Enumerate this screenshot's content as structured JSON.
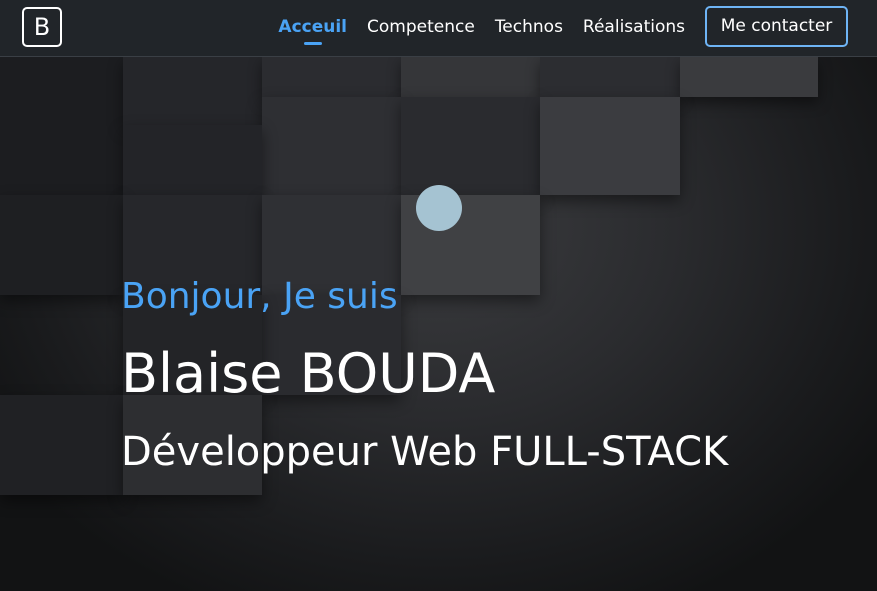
{
  "navbar": {
    "brand_letter": "B",
    "links": [
      {
        "label": "Acceuil",
        "active": true
      },
      {
        "label": "Competence",
        "active": false
      },
      {
        "label": "Technos",
        "active": false
      },
      {
        "label": "Réalisations",
        "active": false
      }
    ],
    "contact_label": "Me contacter"
  },
  "hero": {
    "greeting": "Bonjour, Je suis",
    "name": "Blaise BOUDA",
    "role": "Développeur Web FULL-STACK"
  },
  "colors": {
    "accent": "#4aa3f5",
    "navbar_bg": "#212529",
    "contact_border": "#6eb4f5",
    "ball": "#a5c3d2"
  }
}
